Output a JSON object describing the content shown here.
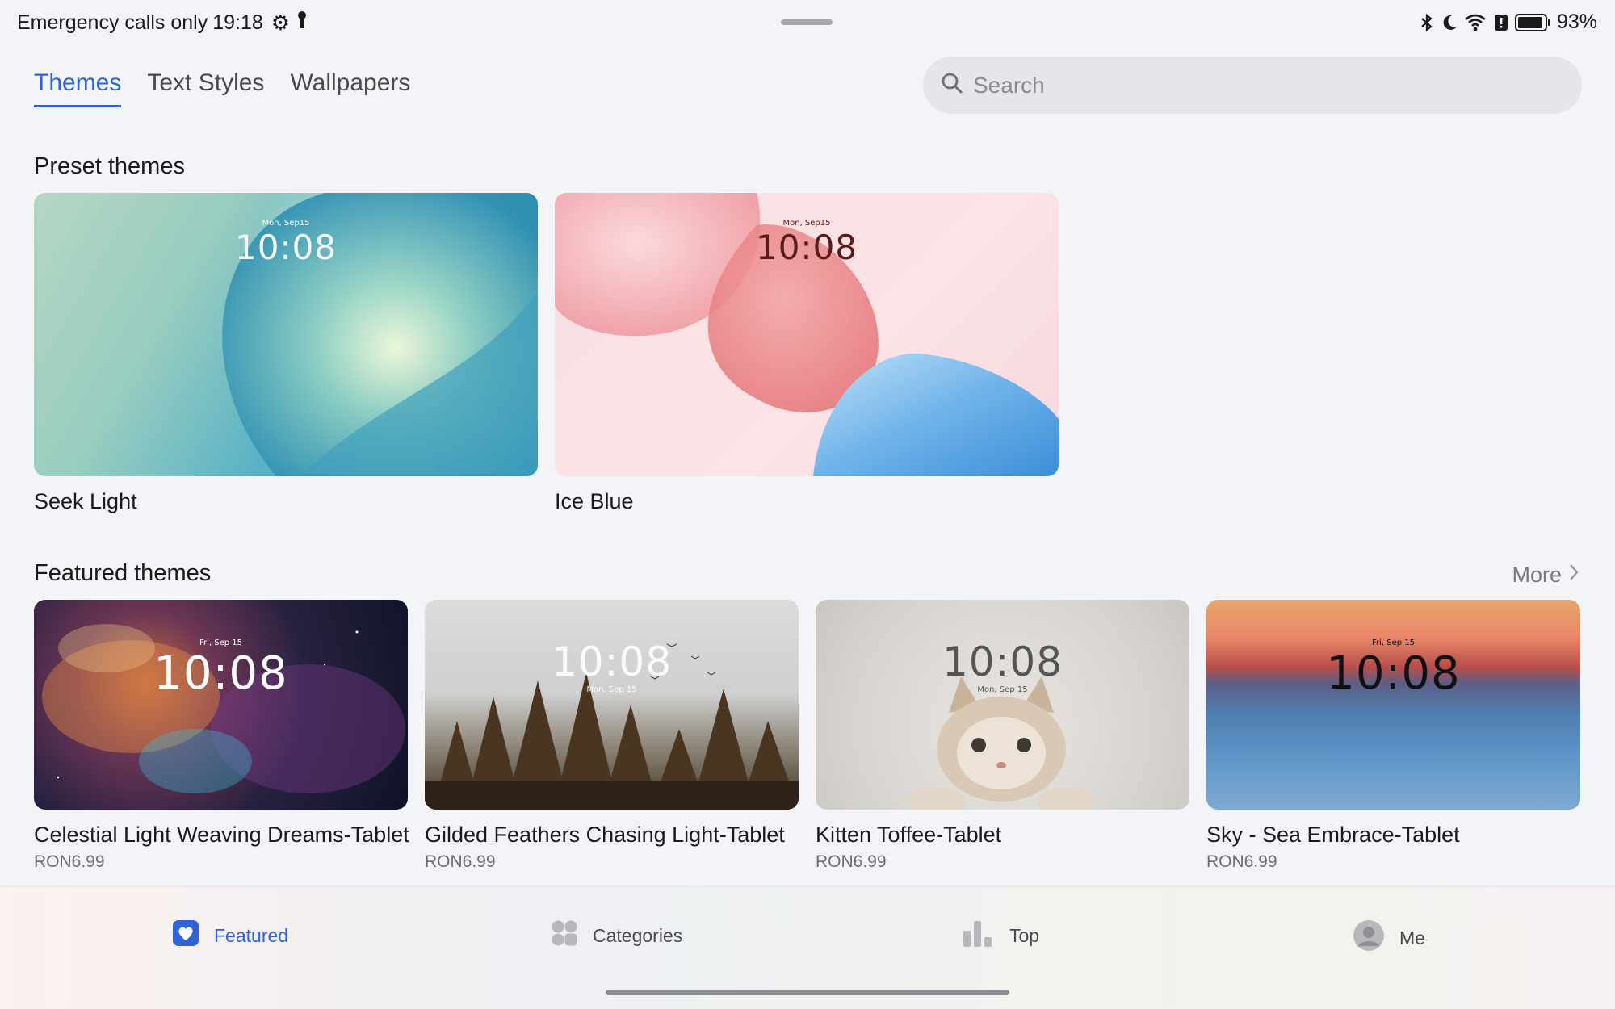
{
  "status_bar": {
    "carrier_text": "Emergency calls only",
    "time": "19:18",
    "battery_percent": "93%",
    "left_icons": [
      "gear-icon",
      "key-icon"
    ],
    "right_icons": [
      "bluetooth-icon",
      "moon-icon",
      "wifi-icon",
      "alert-icon",
      "battery-icon"
    ]
  },
  "tabs": [
    {
      "label": "Themes",
      "active": true
    },
    {
      "label": "Text Styles",
      "active": false
    },
    {
      "label": "Wallpapers",
      "active": false
    }
  ],
  "search": {
    "placeholder": "Search"
  },
  "preset": {
    "title": "Preset themes",
    "items": [
      {
        "name": "Seek Light",
        "clock_date": "Mon, Sep15",
        "clock_time": "10:08"
      },
      {
        "name": "Ice Blue",
        "clock_date": "Mon, Sep15",
        "clock_time": "10:08"
      }
    ]
  },
  "featured": {
    "title": "Featured themes",
    "more_label": "More",
    "items": [
      {
        "name": "Celestial Light Weaving Dreams-Tablet",
        "price": "RON6.99",
        "clock_date": "Fri, Sep 15",
        "clock_time": "10:08"
      },
      {
        "name": "Gilded Feathers Chasing Light-Tablet",
        "price": "RON6.99",
        "clock_date": "Mon, Sep 15",
        "clock_time": "10:08"
      },
      {
        "name": "Kitten Toffee-Tablet",
        "price": "RON6.99",
        "clock_date": "Mon, Sep 15",
        "clock_time": "10:08"
      },
      {
        "name": "Sky - Sea Embrace-Tablet",
        "price": "RON6.99",
        "clock_date": "Fri, Sep 15",
        "clock_time": "10:08"
      }
    ]
  },
  "bottom_nav": [
    {
      "label": "Featured",
      "icon": "heart-icon",
      "active": true
    },
    {
      "label": "Categories",
      "icon": "grid-icon",
      "active": false
    },
    {
      "label": "Top",
      "icon": "bar-chart-icon",
      "active": false
    },
    {
      "label": "Me",
      "icon": "avatar-icon",
      "active": false
    }
  ],
  "colors": {
    "accent": "#2f63d9",
    "background": "#f3f4f8"
  }
}
